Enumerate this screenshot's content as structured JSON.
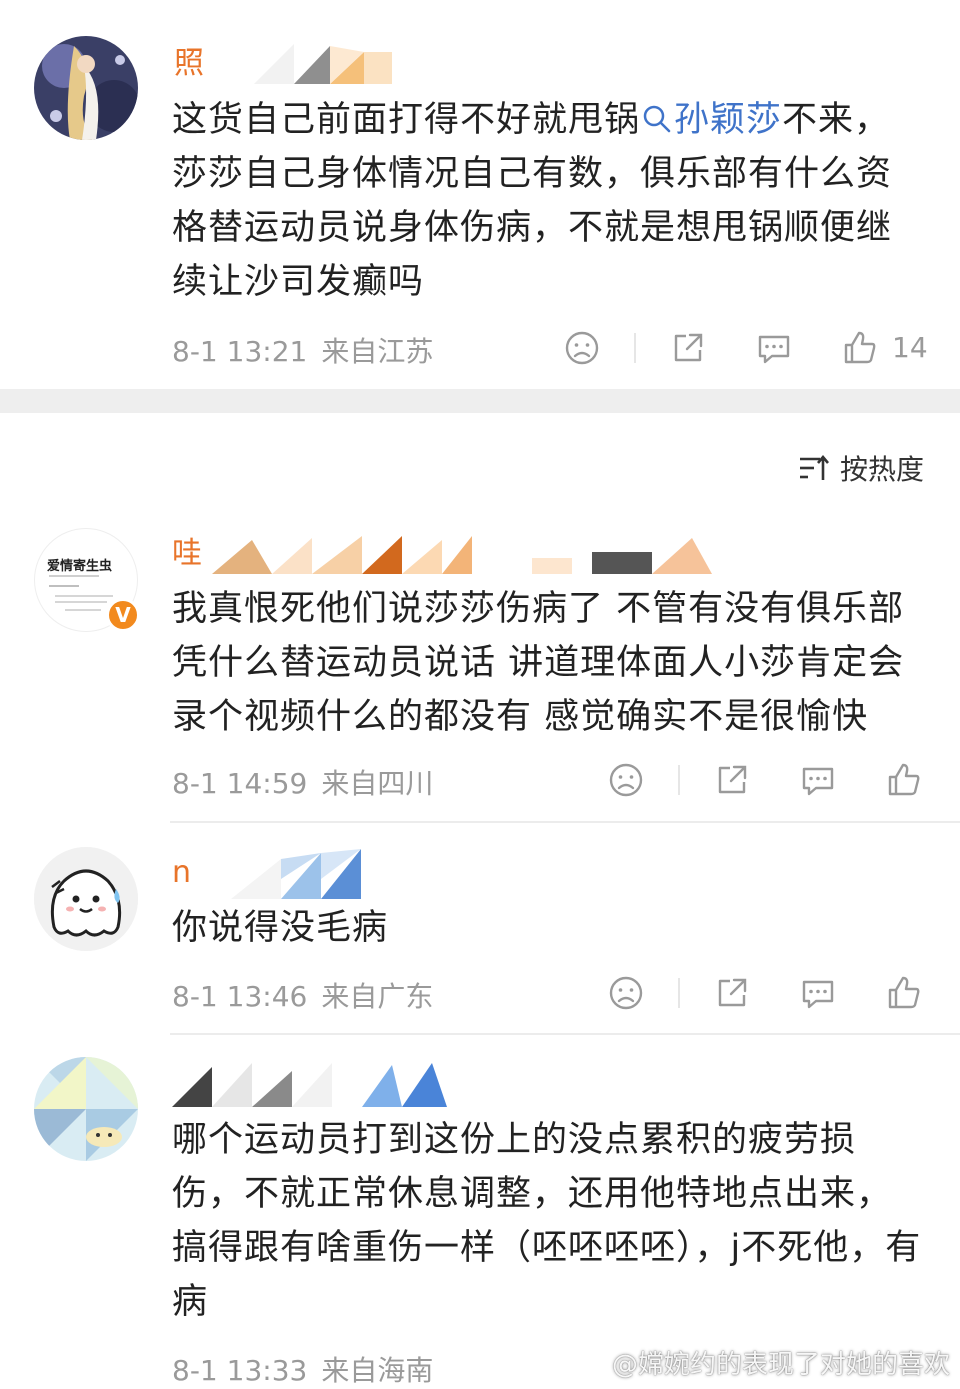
{
  "colors": {
    "username": "#e8742a",
    "link": "#3f73c9",
    "meta": "#9a9a9a",
    "text": "#222222",
    "badge": "#f28a1e"
  },
  "sort_toggle": {
    "icon": "sort-icon",
    "label": "按热度"
  },
  "top_comment": {
    "username_visible": "照",
    "text_before_link": "这货自己前面打得不好就甩锅",
    "link_text": "孙颖莎",
    "text_after_link": "不来，莎莎自己身体情况自己有数，俱乐部有什么资格替运动员说身体伤病，不就是想甩锅顺便继续让沙司发癫吗",
    "time": "8-1 13:21",
    "location": "来自江苏",
    "like_count": "14"
  },
  "comments": [
    {
      "username_visible": "哇",
      "verified_badge": "V",
      "avatar_title": "爱情寄生虫",
      "text": "我真恨死他们说莎莎伤病了 不管有没有俱乐部凭什么替运动员说话 讲道理体面人小莎肯定会录个视频什么的都没有 感觉确实不是很愉快",
      "time": "8-1 14:59",
      "location": "来自四川"
    },
    {
      "username_visible": "n",
      "text": "你说得没毛病",
      "time": "8-1 13:46",
      "location": "来自广东"
    },
    {
      "username_visible": "",
      "text": "哪个运动员打到这份上的没点累积的疲劳损伤，不就正常休息调整，还用他特地点出来，搞得跟有啥重伤一样（呸呸呸呸），j不死他，有病",
      "time": "8-1 13:33",
      "location": "来自海南"
    }
  ],
  "watermark": "@嫦婉约的表现了对她的喜欢"
}
